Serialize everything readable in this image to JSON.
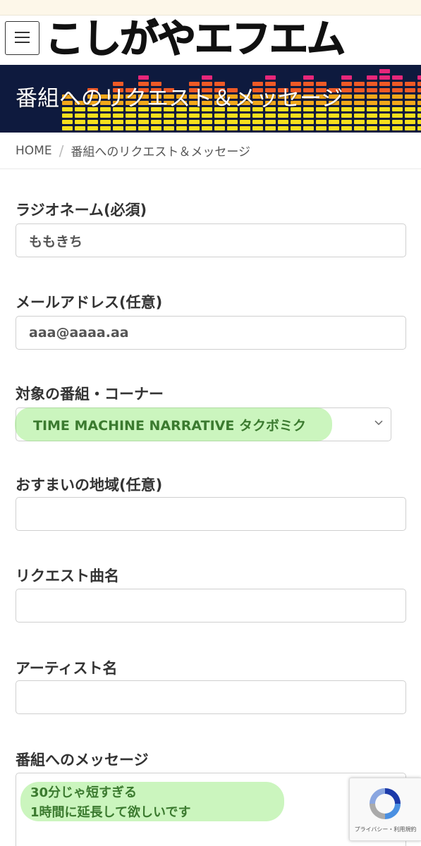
{
  "site": {
    "logo_text": "こしがやエフエム",
    "page_title": "番組へのリクエスト＆メッセージ"
  },
  "breadcrumb": {
    "home": "HOME",
    "current": "番組へのリクエスト＆メッセージ"
  },
  "form": {
    "radio_name": {
      "label": "ラジオネーム(必須)",
      "value": "ももきち"
    },
    "email": {
      "label": "メールアドレス(任意)",
      "value": "aaa@aaaa.aa"
    },
    "program": {
      "label": "対象の番組・コーナー",
      "selected": "TIME MACHINE NARRATIVE タクボミク"
    },
    "area": {
      "label": "おすまいの地域(任意)",
      "value": ""
    },
    "song": {
      "label": "リクエスト曲名",
      "value": ""
    },
    "artist": {
      "label": "アーティスト名",
      "value": ""
    },
    "message": {
      "label": "番組へのメッセージ",
      "lines": [
        "30分じゃ短すぎる",
        "1時間に延長して欲しいです"
      ]
    }
  },
  "recaptcha": {
    "terms": "プライバシー・利用規約"
  },
  "colors": {
    "banner_bg": "#0e1a3e",
    "highlight": "#8ce86e",
    "highlight_text": "#3b7a2f"
  },
  "icons": {
    "menu": "hamburger-menu-icon",
    "select": "chevron-down-icon",
    "recaptcha": "recaptcha-logo-icon"
  }
}
